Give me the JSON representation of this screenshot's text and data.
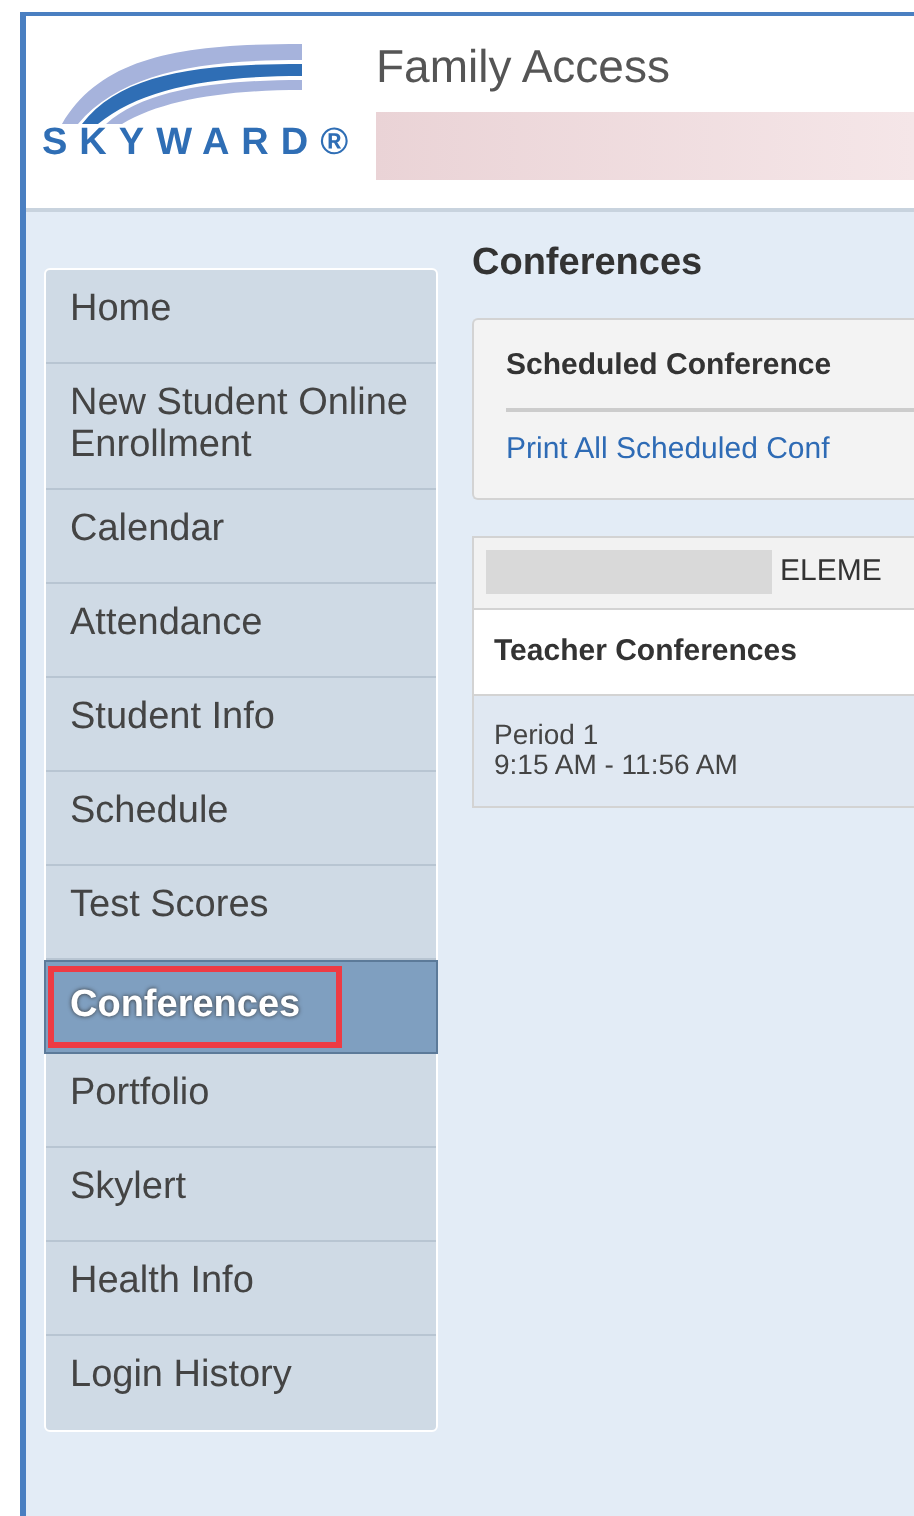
{
  "header": {
    "logo_text": "SKYWARD®",
    "title": "Family Access"
  },
  "sidebar": {
    "items": [
      {
        "label": "Home",
        "selected": false
      },
      {
        "label": "New Student Online Enrollment",
        "selected": false
      },
      {
        "label": "Calendar",
        "selected": false
      },
      {
        "label": "Attendance",
        "selected": false
      },
      {
        "label": "Student Info",
        "selected": false
      },
      {
        "label": "Schedule",
        "selected": false
      },
      {
        "label": "Test Scores",
        "selected": false
      },
      {
        "label": "Conferences",
        "selected": true
      },
      {
        "label": "Portfolio",
        "selected": false
      },
      {
        "label": "Skylert",
        "selected": false
      },
      {
        "label": "Health Info",
        "selected": false
      },
      {
        "label": "Login History",
        "selected": false
      }
    ]
  },
  "main": {
    "heading": "Conferences",
    "scheduled_panel": {
      "title": "Scheduled Conference",
      "link": "Print All Scheduled Conf"
    },
    "school_panel": {
      "school_name": "ELEME",
      "section_title": "Teacher Conferences",
      "rows": [
        {
          "period": "Period 1",
          "time": "9:15 AM - 11:56 AM"
        }
      ]
    }
  }
}
